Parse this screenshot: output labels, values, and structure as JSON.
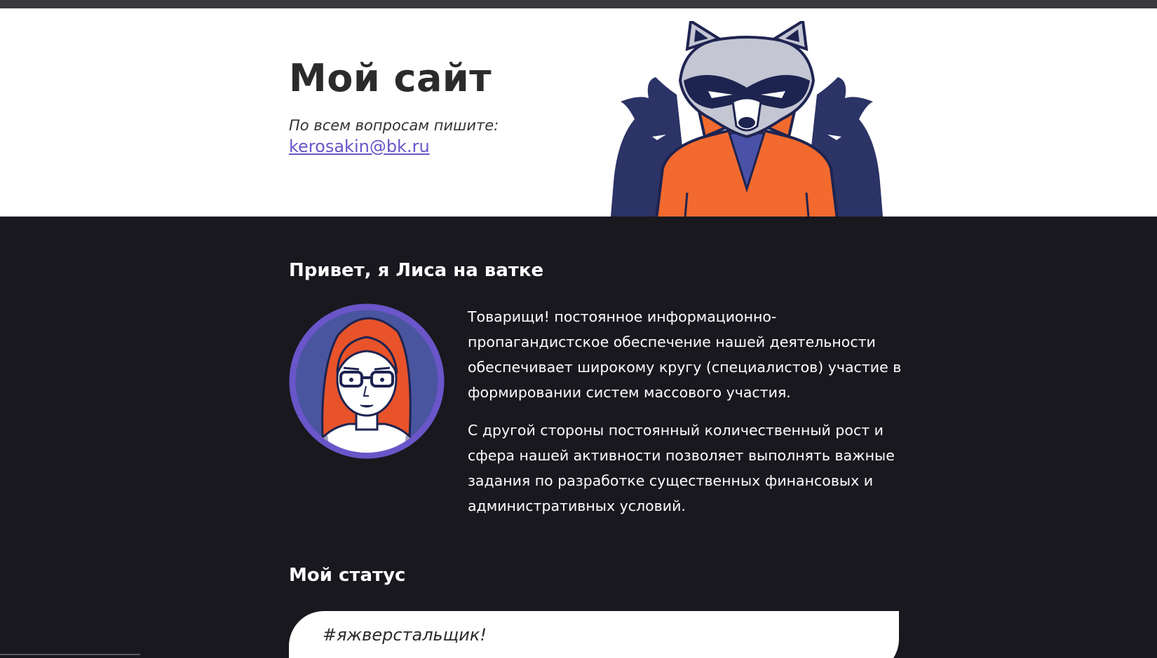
{
  "header": {
    "title": "Мой сайт",
    "contact_text": "По всем вопросам пишите:",
    "email": "kerosakin@bk.ru",
    "mascot_icon": "raccoon-illustration"
  },
  "about": {
    "title": "Привет, я Лиса на ватке",
    "avatar_icon": "woman-avatar",
    "paragraphs": [
      "Товарищи! постоянное информационно-пропагандистское обеспечение нашей деятельности обеспечивает широкому кругу (специалистов) участие в формировании систем массового участия.",
      "С другой стороны постоянный количественный рост и сфера нашей активности позволяет выполнять важные задания по разработке существенных финансовых и административных условий."
    ]
  },
  "status": {
    "title": "Мой статус",
    "text": "#яжверстальщик!"
  },
  "colors": {
    "accent": "#6a55c9",
    "dark_bg": "#19181e",
    "orange": "#f26a2e",
    "navy": "#2c3366"
  }
}
